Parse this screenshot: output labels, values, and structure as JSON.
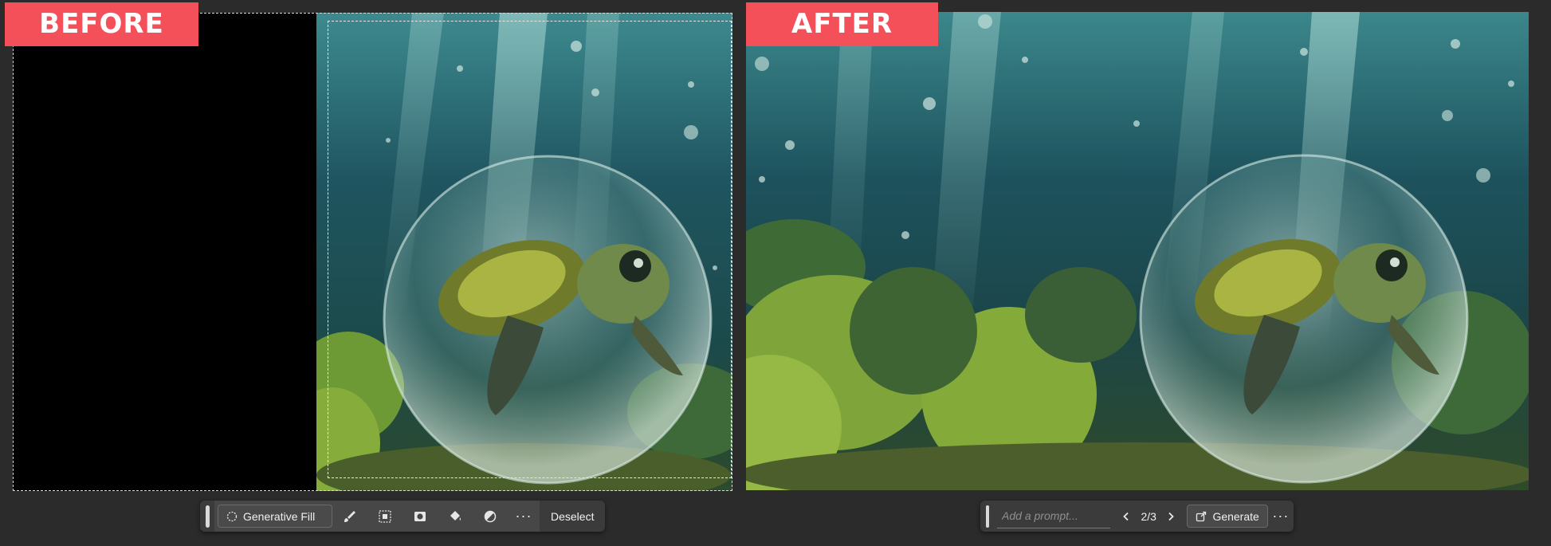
{
  "labels": {
    "before": "BEFORE",
    "after": "AFTER"
  },
  "toolbar_left": {
    "generative_fill_label": "Generative Fill",
    "more_label": "···",
    "deselect_label": "Deselect",
    "icons": [
      "brush-icon",
      "transform-selection-icon",
      "mask-icon",
      "fill-bucket-icon",
      "adjustment-icon"
    ]
  },
  "toolbar_right": {
    "prompt_placeholder": "Add a prompt...",
    "counter": "2/3",
    "generate_label": "Generate",
    "more_label": "···"
  },
  "images": {
    "before": "turtle-in-bubble-original-with-empty-left-area",
    "after": "turtle-in-bubble-extended-with-generated-seaweed"
  },
  "colors": {
    "label_bg": "#f4505a",
    "toolbar_bg": "#3b3b3b",
    "page_bg": "#2b2b2b"
  }
}
